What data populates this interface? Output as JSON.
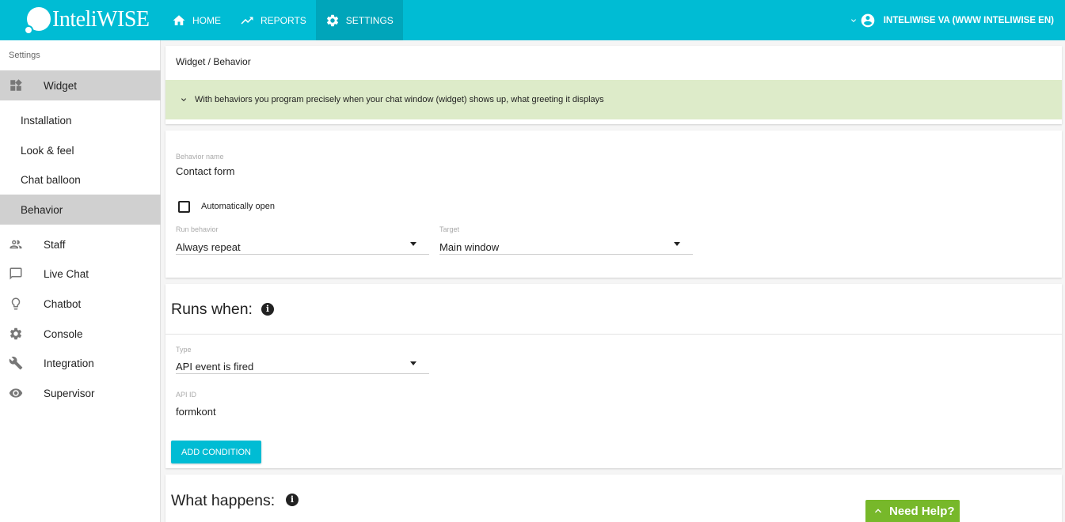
{
  "topbar": {
    "logo_text": "InteliWISE",
    "nav": [
      {
        "label": "HOME",
        "icon": "home-icon"
      },
      {
        "label": "REPORTS",
        "icon": "trending-up-icon"
      },
      {
        "label": "SETTINGS",
        "icon": "gear-icon",
        "active": true
      }
    ],
    "user_name": "INTELIWISE VA (WWW INTELIWISE EN)"
  },
  "sidebar": {
    "title": "Settings",
    "items": [
      {
        "label": "Widget",
        "icon": "widget-icon"
      },
      {
        "label": "Installation"
      },
      {
        "label": "Look & feel"
      },
      {
        "label": "Chat balloon"
      },
      {
        "label": "Behavior"
      },
      {
        "label": "Staff",
        "icon": "people-icon"
      },
      {
        "label": "Live Chat",
        "icon": "chat-icon"
      },
      {
        "label": "Chatbot",
        "icon": "lightbulb-icon"
      },
      {
        "label": "Console",
        "icon": "gear-icon"
      },
      {
        "label": "Integration",
        "icon": "wrench-icon"
      },
      {
        "label": "Supervisor",
        "icon": "eye-icon"
      }
    ]
  },
  "main": {
    "breadcrumb": "Widget / Behavior",
    "info_banner": "With behaviors you program precisely when your chat window (widget) shows up, what greeting it displays",
    "behavior": {
      "name_label": "Behavior name",
      "name_value": "Contact form",
      "auto_open_label": "Automatically open",
      "auto_open_checked": false,
      "run_behavior_label": "Run behavior",
      "run_behavior_value": "Always repeat",
      "target_label": "Target",
      "target_value": "Main window"
    },
    "runs_when": {
      "title": "Runs when:",
      "type_label": "Type",
      "type_value": "API event is fired",
      "api_id_label": "API ID",
      "api_id_value": "formkont",
      "add_condition_label": "ADD CONDITION"
    },
    "what_happens": {
      "title": "What happens:"
    }
  },
  "help": {
    "label": "Need Help?"
  },
  "colors": {
    "primary": "#00bcd4",
    "banner": "#ddebc9",
    "help": "#77b82a"
  }
}
